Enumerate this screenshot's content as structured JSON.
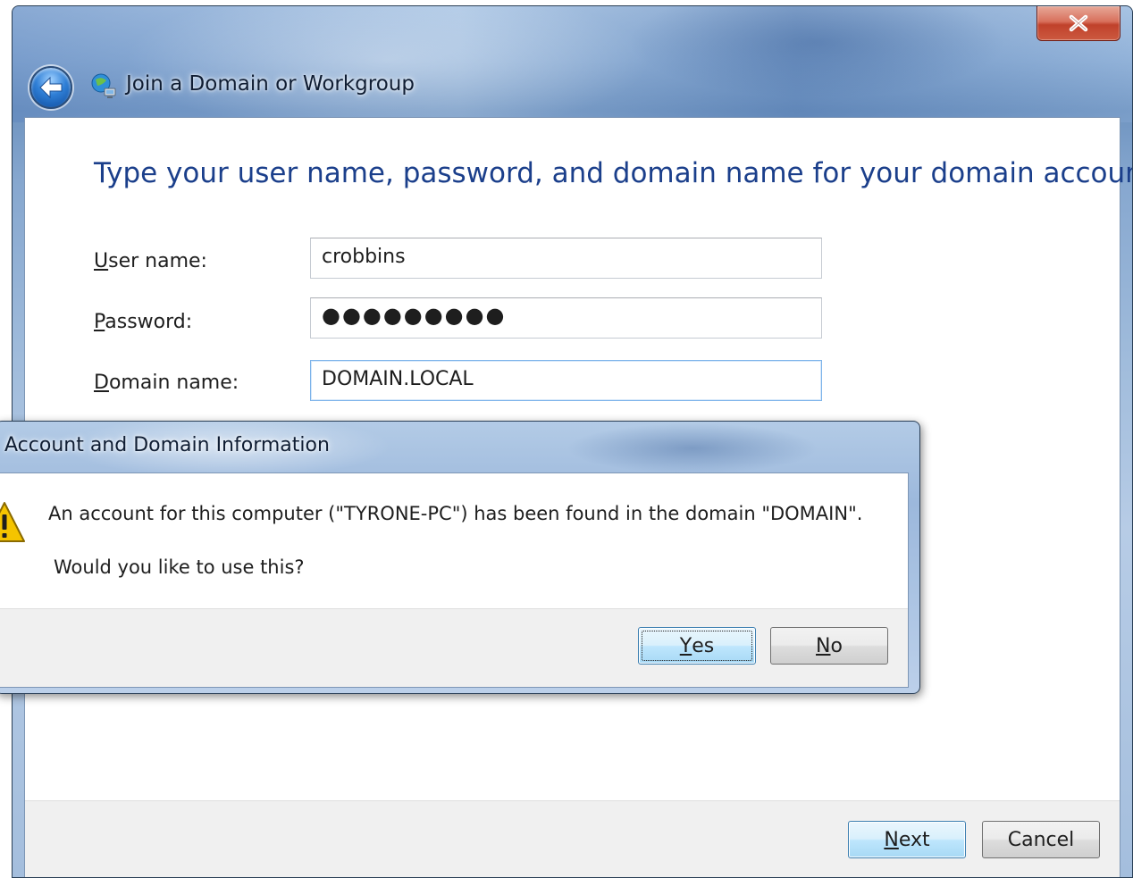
{
  "wizard": {
    "title": "Join a Domain or Workgroup",
    "heading": "Type your user name, password, and domain name for your domain account",
    "fields": {
      "username": {
        "label_accel": "U",
        "label_rest": "ser name:",
        "value": "crobbins"
      },
      "password": {
        "label_accel": "P",
        "label_rest": "assword:",
        "value": "●●●●●●●●●"
      },
      "domain": {
        "label_accel": "D",
        "label_rest": "omain name:",
        "value": "DOMAIN.LOCAL"
      }
    },
    "buttons": {
      "next_accel": "N",
      "next_rest": "ext",
      "cancel": "Cancel"
    }
  },
  "dialog": {
    "title": "Account and Domain Information",
    "message": "An account for this computer (\"TYRONE-PC\") has been found in the domain \"DOMAIN\".",
    "question": "Would you like to use this?",
    "buttons": {
      "yes_accel": "Y",
      "yes_rest": "es",
      "no_accel": "N",
      "no_rest": "o"
    }
  },
  "icons": {
    "close": "close-icon",
    "back": "back-arrow-icon",
    "network": "network-computer-icon",
    "warning": "warning-icon"
  },
  "colors": {
    "heading": "#1b3f8b",
    "close_button": "#c0412b",
    "default_button_border": "#3c7fb1"
  }
}
